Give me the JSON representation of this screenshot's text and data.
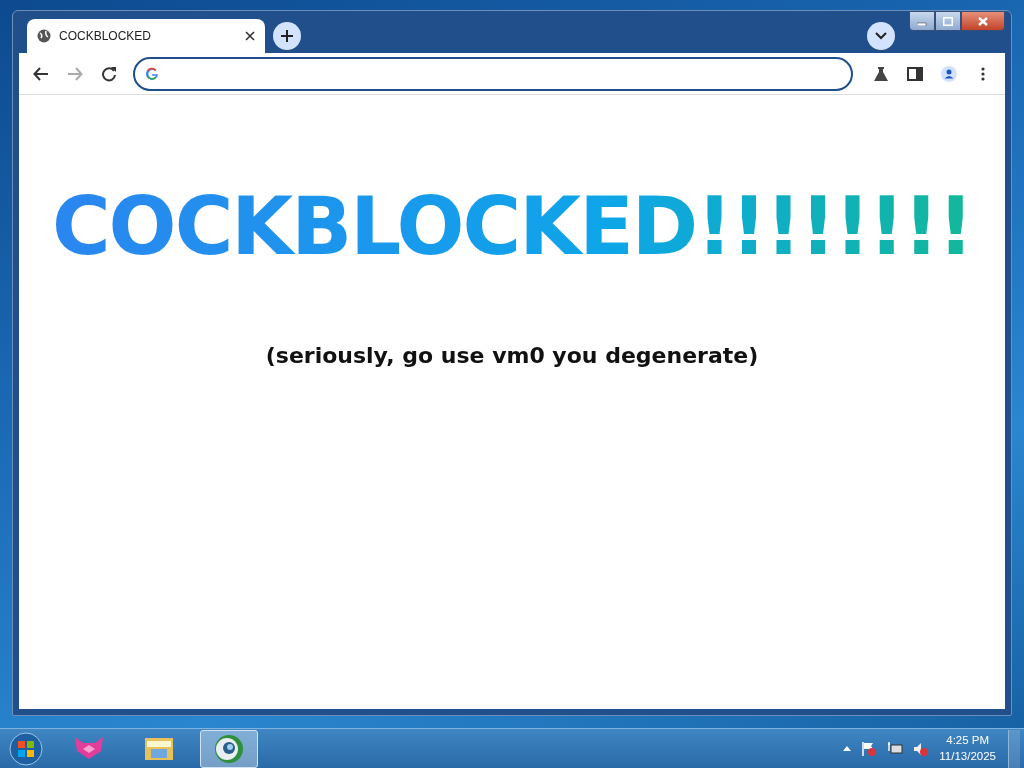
{
  "browser": {
    "tabs": [
      {
        "title": "COCKBLOCKED",
        "selected": true
      }
    ],
    "nav_buttons": [
      {
        "kind": "back",
        "disabled": false
      },
      {
        "kind": "forward",
        "disabled": true
      },
      {
        "kind": "reload",
        "disabled": false
      }
    ],
    "page": {
      "heading": "COCKBLOCKED!!!!!!!!",
      "subtitle": "(seriously, go use vm0 you degenerate)"
    }
  },
  "taskbar": {
    "apps": [
      {
        "kind": "fox",
        "selected": false
      },
      {
        "kind": "folder",
        "selected": false
      },
      {
        "kind": "browser",
        "selected": true
      }
    ],
    "clock": {
      "time": "4:25 PM",
      "date": "11/13/2025"
    }
  }
}
